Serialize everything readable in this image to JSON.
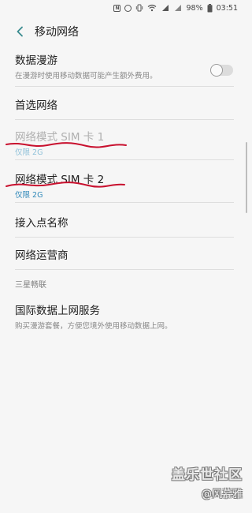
{
  "status": {
    "battery": "98%",
    "time": "03:51"
  },
  "header": {
    "title": "移动网络"
  },
  "settings": {
    "roaming": {
      "label": "数据漫游",
      "desc": "在漫游时使用移动数据可能产生额外费用。",
      "toggle_on": false
    },
    "preferred": {
      "label": "首选网络"
    },
    "sim1": {
      "label": "网络模式 SIM 卡 1",
      "value": "仅限 2G"
    },
    "sim2": {
      "label": "网络模式 SIM 卡 2",
      "value": "仅限 2G"
    },
    "apn": {
      "label": "接入点名称"
    },
    "operator": {
      "label": "网络运营商"
    }
  },
  "samsung": {
    "section_title": "三星畅联",
    "intl": {
      "label": "国际数据上网服务",
      "desc": "购买漫游套餐，方便您境外使用移动数据上网。"
    }
  },
  "watermark": {
    "brand": "盖乐世社区",
    "user": "@风慕雅"
  },
  "colors": {
    "accent": "#2f88b9",
    "annotation": "#c8102e"
  }
}
